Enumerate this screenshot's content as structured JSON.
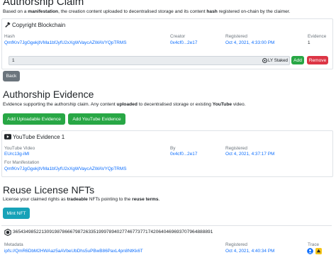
{
  "claim": {
    "title": "Authorship Claim",
    "intro_before": "Based on a ",
    "intro_bold1": "manifestation",
    "intro_mid": ", the creation content uploaded to decentralised storage and its content ",
    "intro_bold2": "hash",
    "intro_after": " registered on-chain by the claimer.",
    "card_title": "Copyright Blockchain",
    "headers": {
      "hash": "Hash",
      "creator": "Creator",
      "registered": "Registered",
      "evidence": "Evidence"
    },
    "hash": "QmfKrv7JgGgekjtVMa1bfJyfU2xXgWVaycAZWAVYQpTRMS",
    "creator": "0x4cf0...2e17",
    "registered": "Oct 4, 2021, 4:33:00 PM",
    "evidence": "1",
    "stake_value": "1",
    "stake_suffix": "LY Staked",
    "add_label": "Add",
    "remove_label": "Remove"
  },
  "back_label": "Back",
  "evidence": {
    "title": "Authorship Evidence",
    "intro_before": "Evidence supporting the authorship claim. Any content ",
    "intro_bold1": "uploaded",
    "intro_mid": " to decentralised storage or existing ",
    "intro_bold2": "YouTube",
    "intro_after": " video.",
    "add_uploadable_label": "Add Uploadable Evidence",
    "add_youtube_label": "Add YouTube Evidence",
    "card_title": "YouTube Evidence 1",
    "headers": {
      "video": "YouTube Video",
      "by": "By",
      "registered": "Registered",
      "manifestation": "For Manifestation"
    },
    "video": "EUrc13g-iMI",
    "by": "0x4cf0...2e17",
    "registered": "Oct 4, 2021, 4:37:17 PM",
    "manifestation": "QmfKrv7JgGgekjtVMa1bfJyfU2xXgWVaycAZWAVYQpTRMS"
  },
  "nfts": {
    "title": "Reuse License NFTs",
    "intro_before": "License your claimed rights as ",
    "intro_bold1": "tradeable",
    "intro_mid": " NFTs pointing to the ",
    "intro_bold2": "reuse terms",
    "intro_after": ".",
    "mint_label": "Mint NFT",
    "token_id": "36543498522130919878666798726335199978940277467737717420640469693707964888891",
    "headers": {
      "metadata": "Metadata",
      "registered": "Registered",
      "trace": "Trace"
    },
    "metadata": "ipfs://QmR6DbM2HWAaz5aAVbeUbDhs5uPBwB86PaxL4pn8NtKk6T",
    "registered": "Oct 4, 2021, 4:40:34 PM"
  },
  "colors": {
    "link": "#0d6efd",
    "success": "#28a745",
    "secondary": "#6c757d",
    "danger": "#dc3545"
  }
}
